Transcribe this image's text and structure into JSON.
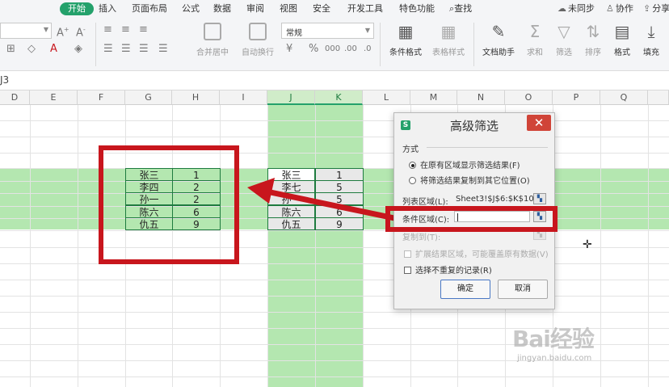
{
  "ribbon": {
    "tabs": [
      "开始",
      "插入",
      "页面布局",
      "公式",
      "数据",
      "审阅",
      "视图",
      "安全",
      "开发工具",
      "特色功能"
    ],
    "active_tab": "开始",
    "search_label": "查找",
    "right": {
      "sync": "未同步",
      "collab": "协作",
      "share": "分享"
    }
  },
  "toolbar": {
    "number_format": "常规",
    "merge_center": "合并居中",
    "wrap_text": "自动换行",
    "percent": "%",
    "cond_format": "条件格式",
    "table_style": "表格样式",
    "doc_assistant": "文档助手",
    "sum": "求和",
    "filter": "筛选",
    "sort": "排序",
    "format": "格式",
    "fill": "填充"
  },
  "name_box": "J3",
  "columns": [
    "D",
    "E",
    "F",
    "G",
    "H",
    "I",
    "J",
    "K",
    "L",
    "M",
    "N",
    "O",
    "P",
    "Q"
  ],
  "left_table": {
    "rows": [
      [
        "张三",
        "1"
      ],
      [
        "李四",
        "2"
      ],
      [
        "孙一",
        "2"
      ],
      [
        "陈六",
        "6"
      ],
      [
        "仇五",
        "9"
      ]
    ]
  },
  "right_table": {
    "rows": [
      [
        "张三",
        "1"
      ],
      [
        "李七",
        "5"
      ],
      [
        "孙一",
        "5"
      ],
      [
        "陈六",
        "6"
      ],
      [
        "仇五",
        "9"
      ]
    ]
  },
  "dialog": {
    "title": "高级筛选",
    "close": "✕",
    "logo": "S",
    "section_method": "方式",
    "radio_in_place": "在原有区域显示筛选结果(F)",
    "radio_copy": "将筛选结果复制到其它位置(O)",
    "list_range_label": "列表区域(L):",
    "list_range_value": "Sheet3!$J$6:$K$10",
    "criteria_label": "条件区域(C):",
    "copy_to_label": "复制到(T):",
    "expand_label": "扩展结果区域，可能覆盖原有数据(V)",
    "unique_label": "选择不重复的记录(R)",
    "ok": "确定",
    "cancel": "取消"
  },
  "watermark": {
    "main": "Bai经验",
    "sub": "jingyan.baidu.com"
  },
  "colors": {
    "accent": "#24a16b",
    "highlight": "#76d470",
    "annotation_red": "#c8161d"
  }
}
